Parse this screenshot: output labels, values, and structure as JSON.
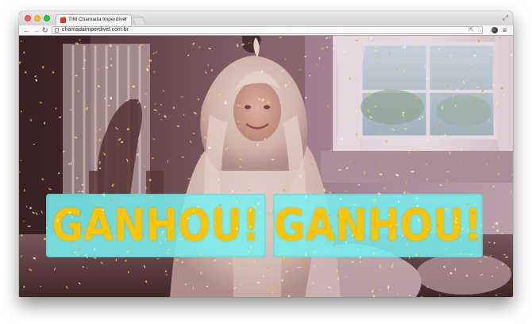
{
  "browser": {
    "tab_title": "TIM Chamada Imperdível",
    "tab_close_glyph": "×",
    "url": "chamadaimperdivel.com.br",
    "icons": {
      "back": "arrow-left",
      "forward": "arrow-right",
      "reload": "reload",
      "cast": "cast",
      "bookmark": "star",
      "extension": "extension",
      "menu": "hamburger-menu"
    },
    "colors": {
      "close": "#fc5f57",
      "minimize": "#fdbc2e",
      "maximize": "#2ac940"
    }
  },
  "page": {
    "banner_left_text": "GANHOU!",
    "banner_right_text": "GANHOU!",
    "colors": {
      "banner_background": "#78eeee",
      "banner_text": "#ffc400"
    }
  }
}
